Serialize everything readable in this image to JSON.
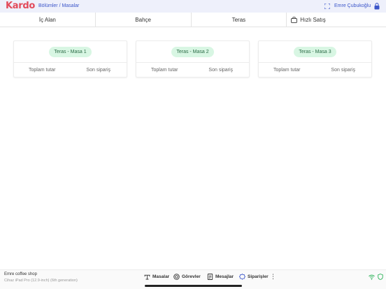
{
  "header": {
    "logo": "Kardo",
    "breadcrumb": "Bölümler / Masalar",
    "user": "Emre Çubukoğlu"
  },
  "tabs": [
    {
      "label": "İç Alan"
    },
    {
      "label": "Bahçe"
    },
    {
      "label": "Teras"
    },
    {
      "label": "Hızlı Satış"
    }
  ],
  "tables": [
    {
      "name": "Teras - Masa 1",
      "total_label": "Toplam tutar",
      "last_order_label": "Son sipariş"
    },
    {
      "name": "Teras - Masa 2",
      "total_label": "Toplam tutar",
      "last_order_label": "Son sipariş"
    },
    {
      "name": "Teras - Masa 3",
      "total_label": "Toplam tutar",
      "last_order_label": "Son sipariş"
    }
  ],
  "footer": {
    "shop_name": "Emre coffee shop",
    "device_name": "Cihaz",
    "device_model": "iPad Pro (12.9-inch) (6th generation)",
    "nav": [
      {
        "label": "Masalar",
        "icon": "table-icon"
      },
      {
        "label": "Görevler",
        "icon": "target-icon"
      },
      {
        "label": "Mesajlar",
        "icon": "document-icon"
      },
      {
        "label": "Siparişler",
        "icon": "badge-icon"
      }
    ],
    "more": "⋮"
  },
  "colors": {
    "accent": "#3b55c9",
    "logo": "#e24a5a",
    "pill_bg": "#d8f6e3",
    "status_green": "#2eb45a"
  }
}
